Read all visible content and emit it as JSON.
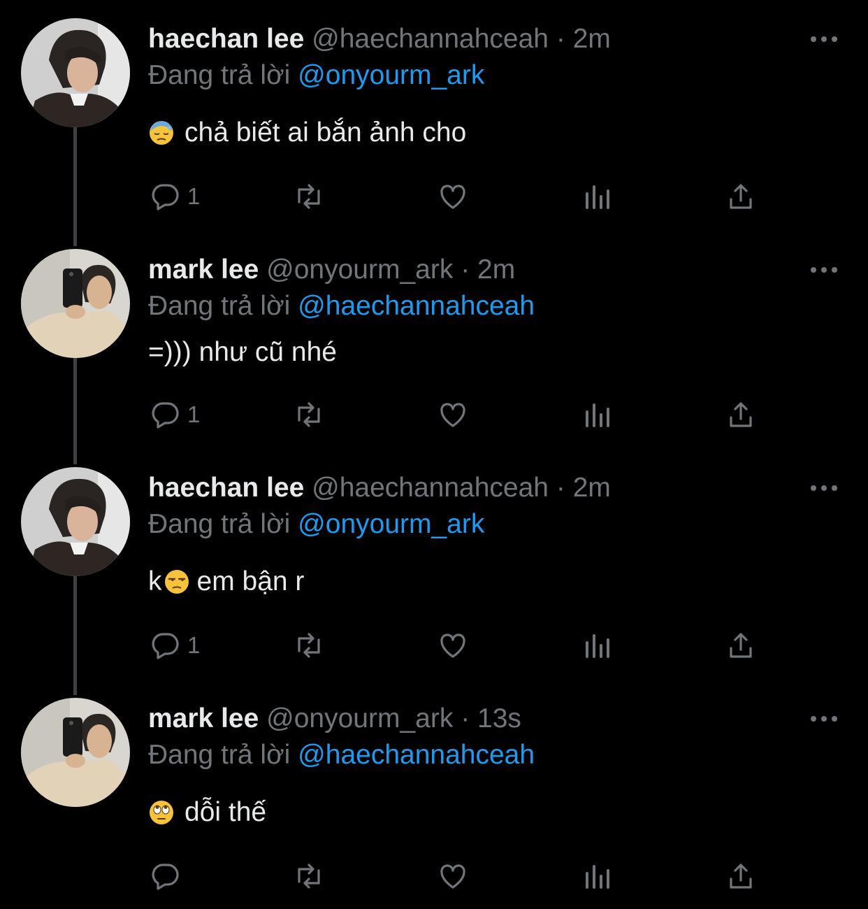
{
  "thread": {
    "reply_prefix": "Đang trả lời",
    "separator": "·",
    "tweets": [
      {
        "display_name": "haechan lee",
        "handle": "@haechannahceah",
        "time": "2m",
        "reply_to": "@onyourm_ark",
        "emoji": "downcast-sweat-face",
        "text": "chả biết ai bắn ảnh cho",
        "text_before_emoji": "",
        "reply_count": "1",
        "avatar": "haechan-avatar"
      },
      {
        "display_name": "mark lee",
        "handle": "@onyourm_ark",
        "time": "2m",
        "reply_to": "@haechannahceah",
        "emoji": "",
        "text": "=))) như cũ nhé",
        "text_before_emoji": "",
        "reply_count": "1",
        "avatar": "mark-avatar"
      },
      {
        "display_name": "haechan lee",
        "handle": "@haechannahceah",
        "time": "2m",
        "reply_to": "@onyourm_ark",
        "emoji": "unamused-face",
        "text": "em bận r",
        "text_before_emoji": "k",
        "reply_count": "1",
        "avatar": "haechan-avatar"
      },
      {
        "display_name": "mark lee",
        "handle": "@onyourm_ark",
        "time": "13s",
        "reply_to": "@haechannahceah",
        "emoji": "eye-roll-face",
        "text": "dỗi thế",
        "text_before_emoji": "",
        "reply_count": "",
        "avatar": "mark-avatar"
      }
    ]
  },
  "colors": {
    "background": "#000000",
    "text_primary": "#e7e9ea",
    "text_secondary": "#71767b",
    "mention": "#1d9bf0",
    "thread_line": "#3e4144"
  },
  "icons": [
    "reply-icon",
    "retweet-icon",
    "like-icon",
    "views-icon",
    "share-icon",
    "more-icon"
  ]
}
